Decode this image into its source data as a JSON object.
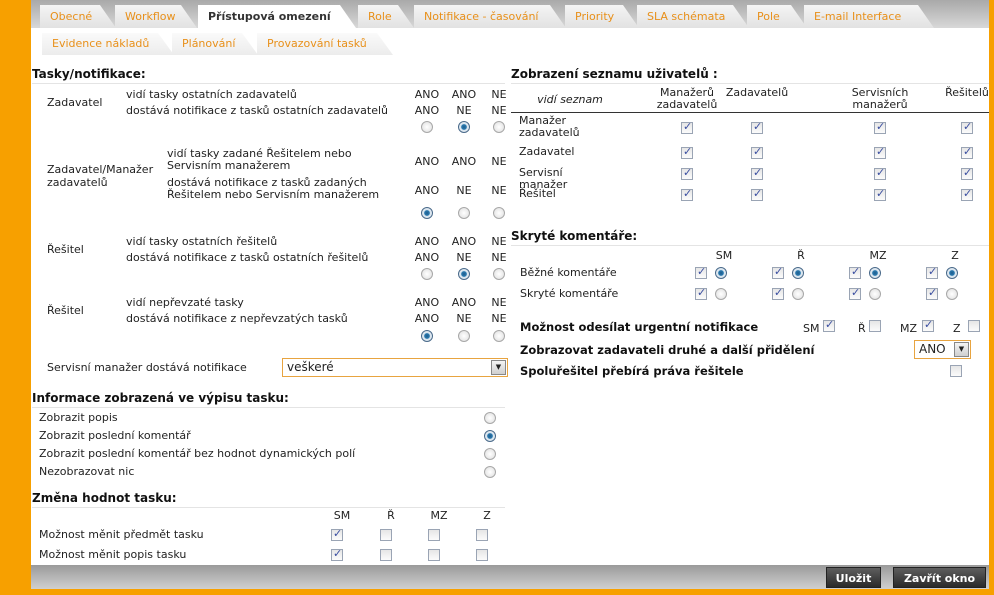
{
  "tabs_row1": [
    "Obecné",
    "Workflow",
    "Přístupová omezení",
    "Role",
    "Notifikace - časování",
    "Priority",
    "SLA schémata",
    "Pole",
    "E-mail Interface"
  ],
  "tabs_row2": [
    "Evidence nákladů",
    "Plánování",
    "Provazování tasků"
  ],
  "active_tab": "Přístupová omezení",
  "tasks": {
    "title": "Tasky/notifikace:",
    "groups": [
      {
        "role": "Zadavatel",
        "lines": [
          "vidí tasky ostatních zadavatelů",
          "dostává notifikace z tasků ostatních zadavatelů"
        ],
        "options": [
          [
            "ANO",
            "ANO"
          ],
          [
            "ANO",
            "NE"
          ],
          [
            "NE",
            "NE"
          ]
        ],
        "selected": 1
      },
      {
        "role": "Zadavatel/Manažer zadavatelů",
        "lines": [
          "vidí tasky zadané Řešitelem nebo Servisním manažerem",
          "dostává notifikace z tasků zadaných Řešitelem nebo Servisním manažerem"
        ],
        "options": [
          [
            "ANO",
            "ANO"
          ],
          [
            "ANO",
            "NE"
          ],
          [
            "NE",
            "NE"
          ]
        ],
        "selected": 0
      },
      {
        "role": "Řešitel",
        "lines": [
          "vidí tasky ostatních řešitelů",
          "dostává notifikace z tasků ostatních řešitelů"
        ],
        "options": [
          [
            "ANO",
            "ANO"
          ],
          [
            "ANO",
            "NE"
          ],
          [
            "NE",
            "NE"
          ]
        ],
        "selected": 1
      },
      {
        "role": "Řešitel",
        "lines": [
          "vidí nepřevzaté tasky",
          "dostává notifikace z nepřevzatých tasků"
        ],
        "options": [
          [
            "ANO",
            "ANO"
          ],
          [
            "ANO",
            "NE"
          ],
          [
            "NE",
            "NE"
          ]
        ],
        "selected": 0
      }
    ],
    "sm_label": "Servisní manažer dostává notifikace",
    "sm_value": "veškeré"
  },
  "info": {
    "title": "Informace zobrazená ve výpisu tasku:",
    "options": [
      "Zobrazit popis",
      "Zobrazit poslední komentář",
      "Zobrazit poslední komentář bez hodnot dynamických polí",
      "Nezobrazovat nic"
    ],
    "selected": 1
  },
  "change": {
    "title": "Změna hodnot tasku:",
    "columns": [
      "SM",
      "Ř",
      "MZ",
      "Z"
    ],
    "rows": [
      {
        "label": "Možnost měnit předmět tasku",
        "checked": [
          true,
          false,
          false,
          false
        ]
      },
      {
        "label": "Možnost měnit popis tasku",
        "checked": [
          true,
          false,
          false,
          false
        ]
      }
    ]
  },
  "users": {
    "title": "Zobrazení seznamu uživatelů :",
    "corner": "vidí seznam",
    "columns": [
      "Manažerů zadavatelů",
      "Zadavatelů",
      "Servisních manažerů",
      "Řešitelů"
    ],
    "rows": [
      {
        "label": "Manažer zadavatelů",
        "checked": [
          true,
          true,
          true,
          true
        ]
      },
      {
        "label": "Zadavatel",
        "checked": [
          true,
          true,
          true,
          true
        ]
      },
      {
        "label": "Servisní manažer",
        "checked": [
          true,
          true,
          true,
          true
        ]
      },
      {
        "label": "Řešitel",
        "checked": [
          true,
          true,
          true,
          true
        ]
      }
    ]
  },
  "hidden": {
    "title": "Skryté komentáře:",
    "columns": [
      "SM",
      "Ř",
      "MZ",
      "Z"
    ],
    "rows": [
      {
        "label": "Běžné komentáře",
        "checked": [
          true,
          true,
          true,
          true
        ],
        "radio": [
          true,
          true,
          true,
          true
        ]
      },
      {
        "label": "Skryté komentáře",
        "checked": [
          true,
          true,
          true,
          true
        ],
        "radio": [
          false,
          false,
          false,
          false
        ]
      }
    ]
  },
  "urgent": {
    "label": "Možnost odesílat urgentní notifikace",
    "items": [
      {
        "label": "SM",
        "checked": true
      },
      {
        "label": "Ř",
        "checked": false
      },
      {
        "label": "MZ",
        "checked": true
      },
      {
        "label": "Z",
        "checked": false
      }
    ]
  },
  "second": {
    "label": "Zobrazovat zadavateli druhé a další přidělení",
    "value": "ANO"
  },
  "cosolver": {
    "label": "Spoluřešitel přebírá práva řešitele",
    "checked": false
  },
  "buttons": {
    "save": "Uložit",
    "close": "Zavřít okno"
  }
}
